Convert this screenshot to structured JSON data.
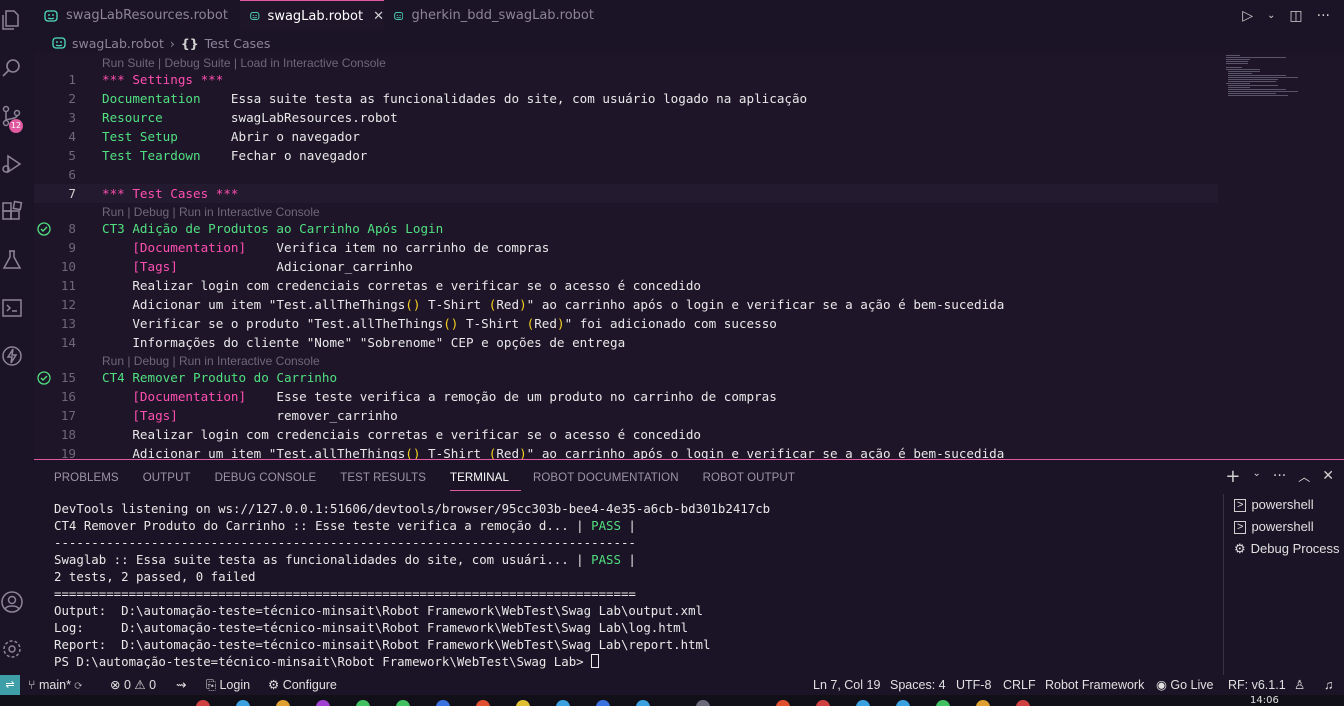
{
  "tabs": [
    {
      "label": "swagLabResources.robot"
    },
    {
      "label": "swagLab.robot"
    },
    {
      "label": "gherkin_bdd_swagLab.robot"
    }
  ],
  "breadcrumb": {
    "file": "swagLab.robot",
    "symbol_glyph": "{}",
    "section": "Test Cases"
  },
  "activity": {
    "badge": "12"
  },
  "editor": {
    "lens_suite": "Run Suite | Debug Suite | Load in Interactive Console",
    "lens_test": "Run | Debug | Run in Interactive Console",
    "lines": [
      {
        "n": "1",
        "a": "*** Settings ***"
      },
      {
        "n": "2",
        "a": "Documentation",
        "b": "    Essa suite testa as funcionalidades do site, com usuário logado na aplicação"
      },
      {
        "n": "3",
        "a": "Resource",
        "b": "         swagLabResources.robot"
      },
      {
        "n": "4",
        "a": "Test Setup",
        "b": "       Abrir o navegador"
      },
      {
        "n": "5",
        "a": "Test Teardown",
        "b": "    Fechar o navegador"
      },
      {
        "n": "6",
        "a": ""
      },
      {
        "n": "7",
        "a": "*** Test Cases ***"
      },
      {
        "n": "8",
        "a": "CT3 Adição de Produtos ao Carrinho Após Login"
      },
      {
        "n": "9",
        "a": "    [Documentation]",
        "b": "    Verifica item no carrinho de compras"
      },
      {
        "n": "10",
        "a": "    [Tags]",
        "b": "             Adicionar_carrinho"
      },
      {
        "n": "11",
        "b": "    Realizar login com credenciais corretas e verificar se o acesso é concedido"
      },
      {
        "n": "12",
        "b": "    Adicionar um item \"Test.allTheThings",
        "p1": "()",
        "c": " T-Shirt ",
        "p2": "(",
        "d": "Red",
        "p3": ")",
        "e": "\" ao carrinho após o login e verificar se a ação é bem-sucedida"
      },
      {
        "n": "13",
        "b": "    Verificar se o produto \"Test.allTheThings",
        "p1": "()",
        "c": " T-Shirt ",
        "p2": "(",
        "d": "Red",
        "p3": ")",
        "e": "\" foi adicionado com sucesso"
      },
      {
        "n": "14",
        "b": "    Informações do cliente \"Nome\" \"Sobrenome\" CEP e opções de entrega"
      },
      {
        "n": "15",
        "a": "CT4 Remover Produto do Carrinho"
      },
      {
        "n": "16",
        "a": "    [Documentation]",
        "b": "    Esse teste verifica a remoção de um produto no carrinho de compras"
      },
      {
        "n": "17",
        "a": "    [Tags]",
        "b": "             remover_carrinho"
      },
      {
        "n": "18",
        "b": "    Realizar login com credenciais corretas e verificar se o acesso é concedido"
      },
      {
        "n": "19",
        "b": "    Adicionar um item \"Test.allTheThings",
        "p1": "()",
        "c": " T-Shirt ",
        "p2": "(",
        "d": "Red",
        "p3": ")",
        "e": "\" ao carrinho após o login e verificar se a ação é bem-sucedida"
      }
    ]
  },
  "panel": {
    "tabs": [
      "PROBLEMS",
      "OUTPUT",
      "DEBUG CONSOLE",
      "TEST RESULTS",
      "TERMINAL",
      "ROBOT DOCUMENTATION",
      "ROBOT OUTPUT"
    ],
    "active_tab": "TERMINAL",
    "terminal_lines": [
      "DevTools listening on ws://127.0.0.1:51606/devtools/browser/95cc303b-bee4-4e35-a6cb-bd301b2417cb",
      "CT4 Remover Produto do Carrinho :: Esse teste verifica a remoção d... | PASS |",
      "------------------------------------------------------------------------------",
      "Swaglab :: Essa suite testa as funcionalidades do site, com usuári... | PASS |",
      "2 tests, 2 passed, 0 failed",
      "==============================================================================",
      "Output:  D:\\automação-teste=técnico-minsait\\Robot Framework\\WebTest\\Swag Lab\\output.xml",
      "Log:     D:\\automação-teste=técnico-minsait\\Robot Framework\\WebTest\\Swag Lab\\log.html",
      "Report:  D:\\automação-teste=técnico-minsait\\Robot Framework\\WebTest\\Swag Lab\\report.html",
      "PS D:\\automação-teste=técnico-minsait\\Robot Framework\\WebTest\\Swag Lab> "
    ],
    "terminals": [
      "powershell",
      "powershell",
      "Debug Process"
    ]
  },
  "status": {
    "branch": "main*",
    "errors": "0",
    "warnings": "0",
    "login": "Login",
    "configure": "Configure",
    "position": "Ln 7, Col 19",
    "spaces": "Spaces: 4",
    "encoding": "UTF-8",
    "eol": "CRLF",
    "language": "Robot Framework",
    "golive": "Go Live",
    "rf": "RF: v6.1.1",
    "time": "14:06"
  },
  "colors": {
    "accent": "#e05aa0",
    "keyword": "#50e080",
    "setting": "#ff4fb0",
    "paren": "#f6d21e",
    "background": "#1e1529"
  }
}
